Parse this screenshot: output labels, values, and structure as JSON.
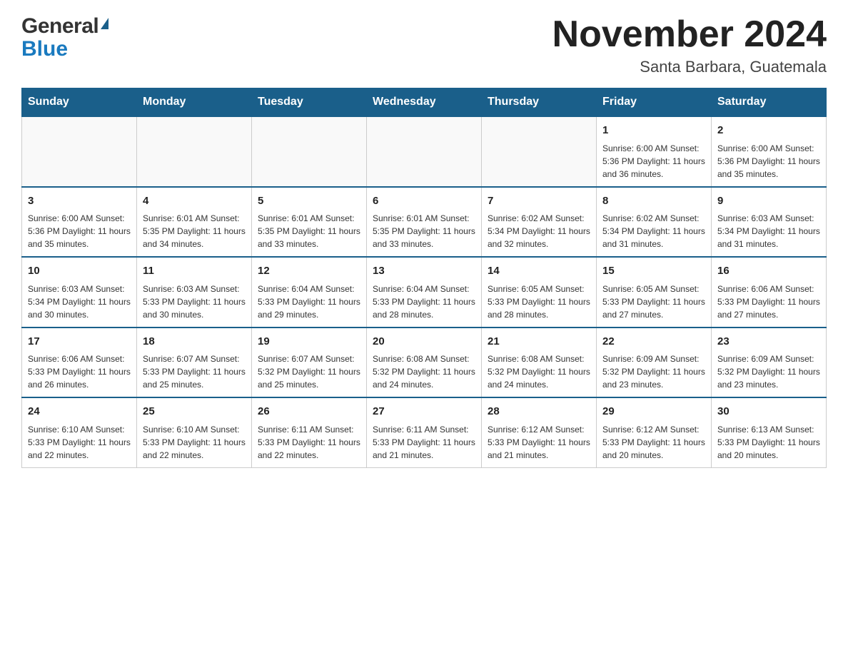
{
  "logo": {
    "general": "General",
    "blue": "Blue",
    "icon": "triangle-icon"
  },
  "header": {
    "month_year": "November 2024",
    "location": "Santa Barbara, Guatemala"
  },
  "weekdays": [
    "Sunday",
    "Monday",
    "Tuesday",
    "Wednesday",
    "Thursday",
    "Friday",
    "Saturday"
  ],
  "weeks": [
    [
      {
        "day": "",
        "info": ""
      },
      {
        "day": "",
        "info": ""
      },
      {
        "day": "",
        "info": ""
      },
      {
        "day": "",
        "info": ""
      },
      {
        "day": "",
        "info": ""
      },
      {
        "day": "1",
        "info": "Sunrise: 6:00 AM\nSunset: 5:36 PM\nDaylight: 11 hours\nand 36 minutes."
      },
      {
        "day": "2",
        "info": "Sunrise: 6:00 AM\nSunset: 5:36 PM\nDaylight: 11 hours\nand 35 minutes."
      }
    ],
    [
      {
        "day": "3",
        "info": "Sunrise: 6:00 AM\nSunset: 5:36 PM\nDaylight: 11 hours\nand 35 minutes."
      },
      {
        "day": "4",
        "info": "Sunrise: 6:01 AM\nSunset: 5:35 PM\nDaylight: 11 hours\nand 34 minutes."
      },
      {
        "day": "5",
        "info": "Sunrise: 6:01 AM\nSunset: 5:35 PM\nDaylight: 11 hours\nand 33 minutes."
      },
      {
        "day": "6",
        "info": "Sunrise: 6:01 AM\nSunset: 5:35 PM\nDaylight: 11 hours\nand 33 minutes."
      },
      {
        "day": "7",
        "info": "Sunrise: 6:02 AM\nSunset: 5:34 PM\nDaylight: 11 hours\nand 32 minutes."
      },
      {
        "day": "8",
        "info": "Sunrise: 6:02 AM\nSunset: 5:34 PM\nDaylight: 11 hours\nand 31 minutes."
      },
      {
        "day": "9",
        "info": "Sunrise: 6:03 AM\nSunset: 5:34 PM\nDaylight: 11 hours\nand 31 minutes."
      }
    ],
    [
      {
        "day": "10",
        "info": "Sunrise: 6:03 AM\nSunset: 5:34 PM\nDaylight: 11 hours\nand 30 minutes."
      },
      {
        "day": "11",
        "info": "Sunrise: 6:03 AM\nSunset: 5:33 PM\nDaylight: 11 hours\nand 30 minutes."
      },
      {
        "day": "12",
        "info": "Sunrise: 6:04 AM\nSunset: 5:33 PM\nDaylight: 11 hours\nand 29 minutes."
      },
      {
        "day": "13",
        "info": "Sunrise: 6:04 AM\nSunset: 5:33 PM\nDaylight: 11 hours\nand 28 minutes."
      },
      {
        "day": "14",
        "info": "Sunrise: 6:05 AM\nSunset: 5:33 PM\nDaylight: 11 hours\nand 28 minutes."
      },
      {
        "day": "15",
        "info": "Sunrise: 6:05 AM\nSunset: 5:33 PM\nDaylight: 11 hours\nand 27 minutes."
      },
      {
        "day": "16",
        "info": "Sunrise: 6:06 AM\nSunset: 5:33 PM\nDaylight: 11 hours\nand 27 minutes."
      }
    ],
    [
      {
        "day": "17",
        "info": "Sunrise: 6:06 AM\nSunset: 5:33 PM\nDaylight: 11 hours\nand 26 minutes."
      },
      {
        "day": "18",
        "info": "Sunrise: 6:07 AM\nSunset: 5:33 PM\nDaylight: 11 hours\nand 25 minutes."
      },
      {
        "day": "19",
        "info": "Sunrise: 6:07 AM\nSunset: 5:32 PM\nDaylight: 11 hours\nand 25 minutes."
      },
      {
        "day": "20",
        "info": "Sunrise: 6:08 AM\nSunset: 5:32 PM\nDaylight: 11 hours\nand 24 minutes."
      },
      {
        "day": "21",
        "info": "Sunrise: 6:08 AM\nSunset: 5:32 PM\nDaylight: 11 hours\nand 24 minutes."
      },
      {
        "day": "22",
        "info": "Sunrise: 6:09 AM\nSunset: 5:32 PM\nDaylight: 11 hours\nand 23 minutes."
      },
      {
        "day": "23",
        "info": "Sunrise: 6:09 AM\nSunset: 5:32 PM\nDaylight: 11 hours\nand 23 minutes."
      }
    ],
    [
      {
        "day": "24",
        "info": "Sunrise: 6:10 AM\nSunset: 5:33 PM\nDaylight: 11 hours\nand 22 minutes."
      },
      {
        "day": "25",
        "info": "Sunrise: 6:10 AM\nSunset: 5:33 PM\nDaylight: 11 hours\nand 22 minutes."
      },
      {
        "day": "26",
        "info": "Sunrise: 6:11 AM\nSunset: 5:33 PM\nDaylight: 11 hours\nand 22 minutes."
      },
      {
        "day": "27",
        "info": "Sunrise: 6:11 AM\nSunset: 5:33 PM\nDaylight: 11 hours\nand 21 minutes."
      },
      {
        "day": "28",
        "info": "Sunrise: 6:12 AM\nSunset: 5:33 PM\nDaylight: 11 hours\nand 21 minutes."
      },
      {
        "day": "29",
        "info": "Sunrise: 6:12 AM\nSunset: 5:33 PM\nDaylight: 11 hours\nand 20 minutes."
      },
      {
        "day": "30",
        "info": "Sunrise: 6:13 AM\nSunset: 5:33 PM\nDaylight: 11 hours\nand 20 minutes."
      }
    ]
  ]
}
